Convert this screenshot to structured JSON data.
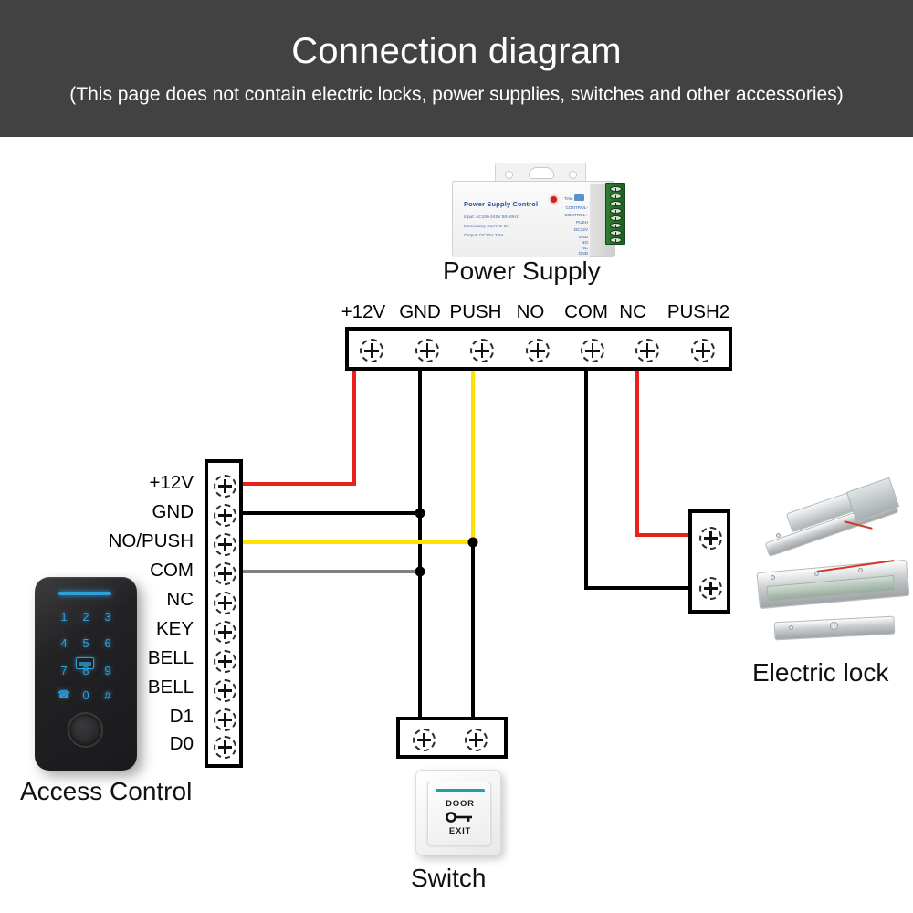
{
  "header": {
    "title": "Connection diagram",
    "subtitle": "(This page does not contain electric locks, power supplies, switches and other accessories)"
  },
  "captions": {
    "power_supply": "Power Supply",
    "access_control": "Access Control",
    "switch": "Switch",
    "electric_lock": "Electric lock"
  },
  "power_supply_device": {
    "brand": "Power Supply Control",
    "spec_lines": [
      "Input: AC100-240V 50-60Hz",
      "Momentary Current: 5A",
      "Output: DC12V 3.0A"
    ],
    "time_label": "Time",
    "terminal_labels": [
      "CONTROL-",
      "CONTROL+",
      "PUSH",
      "DC12V",
      "GND",
      "NO",
      "NC",
      "GND"
    ]
  },
  "power_terminal_block": {
    "labels": [
      "+12V",
      "GND",
      "PUSH",
      "NO",
      "COM",
      "NC",
      "PUSH2"
    ]
  },
  "access_terminal_block": {
    "labels": [
      "+12V",
      "GND",
      "NO/PUSH",
      "COM",
      "NC",
      "KEY",
      "BELL",
      "BELL",
      "D1",
      "D0"
    ]
  },
  "exit_switch": {
    "top_text": "DOOR",
    "bottom_text": "EXIT"
  },
  "keypad": {
    "keys": [
      "1",
      "2",
      "3",
      "4",
      "5",
      "6",
      "7",
      "8",
      "9",
      "☎",
      "0",
      "#"
    ]
  },
  "colors": {
    "header_bg": "#424242",
    "wire_red": "#e8211b",
    "wire_black": "#000000",
    "wire_yellow": "#ffe000",
    "wire_gray": "#808080",
    "accent_blue": "#2f9fd8"
  }
}
